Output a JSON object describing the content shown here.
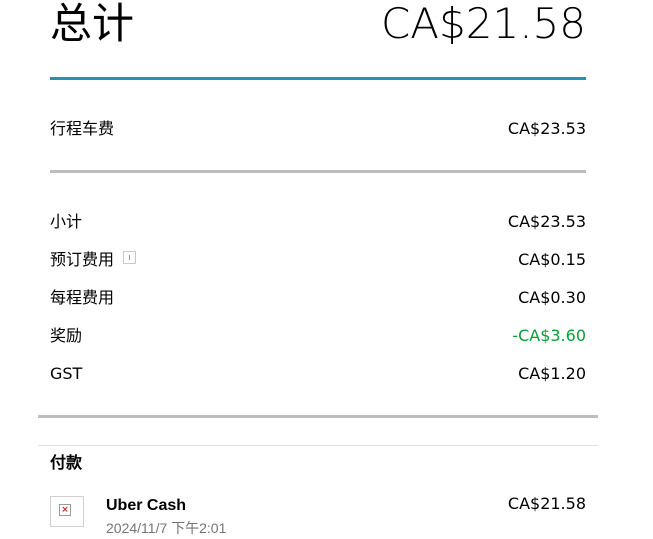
{
  "summary": {
    "total_label": "总计",
    "total_value": "CA$21.58"
  },
  "fare": {
    "label": "行程车费",
    "value": "CA$23.53"
  },
  "breakdown": [
    {
      "label": "小计",
      "value": "CA$23.53"
    },
    {
      "label": "预订费用",
      "value": "CA$0.15",
      "has_info_icon": true
    },
    {
      "label": "每程费用",
      "value": "CA$0.30"
    },
    {
      "label": "奖励",
      "value": "-CA$3.60",
      "value_color": "#06a038"
    },
    {
      "label": "GST",
      "value": "CA$1.20"
    }
  ],
  "payments": {
    "title": "付款",
    "items": [
      {
        "method": "Uber Cash",
        "date": "2024/11/7 下午2:01",
        "amount": "CA$21.58",
        "icon": "broken-image-icon"
      }
    ]
  },
  "colors": {
    "accent_rule": "#1a9aa6",
    "divider": "#bdbdbd",
    "discount": "#06a038",
    "muted_text": "#757575"
  }
}
